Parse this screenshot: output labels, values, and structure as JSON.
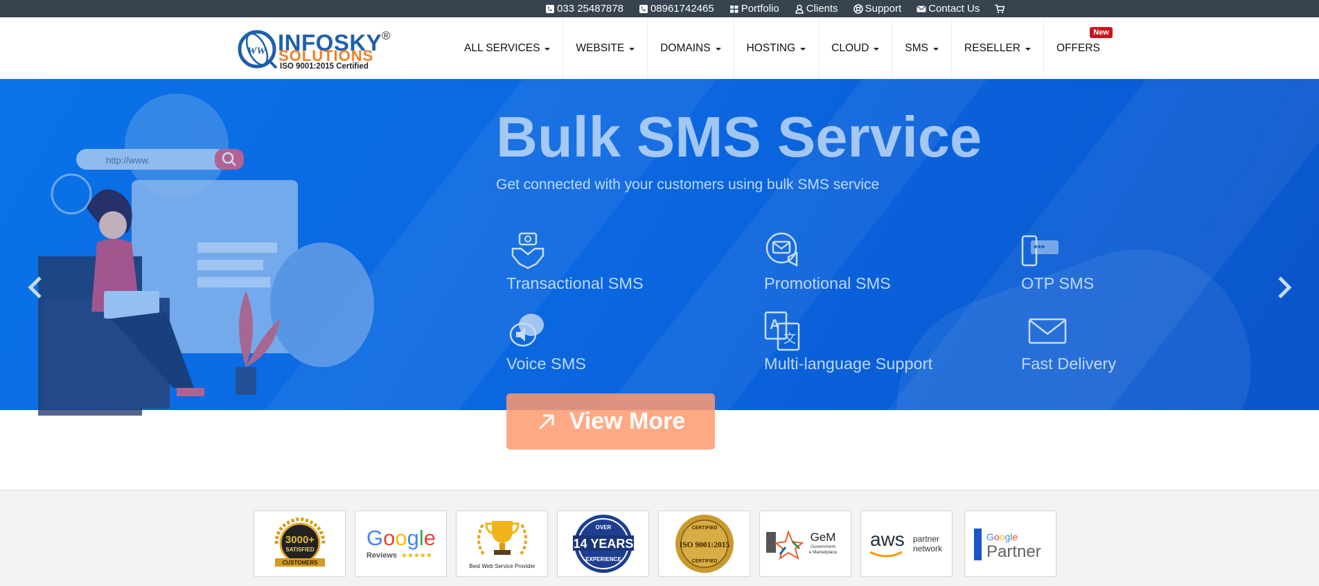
{
  "topbar": {
    "links": [
      {
        "label": "033 25487878",
        "icon": "phone-icon"
      },
      {
        "label": "08961742465",
        "icon": "phone-icon"
      },
      {
        "label": "Portfolio",
        "icon": "grid-icon"
      },
      {
        "label": "Clients",
        "icon": "user-icon"
      },
      {
        "label": "Support",
        "icon": "lifebuoy-icon"
      },
      {
        "label": "Contact Us",
        "icon": "envelope-icon"
      },
      {
        "label": "",
        "icon": "cart-icon"
      }
    ]
  },
  "logo": {
    "title": "INFOSKY",
    "registered": "®",
    "subtitle": "SOLUTIONS",
    "certification": "ISO 9001:2015 Certified"
  },
  "nav": {
    "items": [
      {
        "label": "ALL SERVICES",
        "dropdown": true
      },
      {
        "label": "WEBSITE",
        "dropdown": true
      },
      {
        "label": "DOMAINS",
        "dropdown": true
      },
      {
        "label": "HOSTING",
        "dropdown": true
      },
      {
        "label": "CLOUD",
        "dropdown": true
      },
      {
        "label": "SMS",
        "dropdown": true
      },
      {
        "label": "RESELLER",
        "dropdown": true
      },
      {
        "label": "OFFERS",
        "dropdown": false,
        "badge": "New"
      }
    ]
  },
  "hero": {
    "title": "Bulk SMS Service",
    "subtitle": "Get connected with your customers using bulk SMS service",
    "search_placeholder": "http://www.",
    "features": [
      {
        "label": "Transactional SMS",
        "icon": "handshake-icon"
      },
      {
        "label": "Promotional SMS",
        "icon": "envelope-megaphone-icon"
      },
      {
        "label": "OTP SMS",
        "icon": "phone-password-icon"
      },
      {
        "label": "Voice SMS",
        "icon": "speaker-bubble-icon"
      },
      {
        "label": "Multi-language Support",
        "icon": "translate-icon"
      },
      {
        "label": "Fast Delivery",
        "icon": "envelope-icon"
      }
    ],
    "cta": "View More",
    "colors": {
      "primary": "#0a6be3",
      "cta": "#ff9a6e"
    }
  },
  "badges": {
    "items": [
      {
        "name": "satisfied-customers-badge",
        "line1": "3000+",
        "line2": "SATISFIED",
        "line3": "CUSTOMERS"
      },
      {
        "name": "google-reviews-badge",
        "line1": "Google",
        "line2": "Reviews"
      },
      {
        "name": "best-web-service-badge",
        "line1": "Best Web Service Provider"
      },
      {
        "name": "years-experience-badge",
        "line1": "OVER",
        "line2": "14 YEARS",
        "line3": "EXPERIENCE"
      },
      {
        "name": "iso-certified-badge",
        "line1": "CERTIFIED",
        "line2": "ISO 9001:2015",
        "line3": "CERTIFIED"
      },
      {
        "name": "gem-badge",
        "line1": "GeM",
        "line2": "Government",
        "line3": "e Marketplace"
      },
      {
        "name": "aws-partner-badge",
        "line1": "aws",
        "line2": "partner",
        "line3": "network"
      },
      {
        "name": "google-partner-badge",
        "line1": "Google",
        "line2": "Partner"
      }
    ]
  }
}
